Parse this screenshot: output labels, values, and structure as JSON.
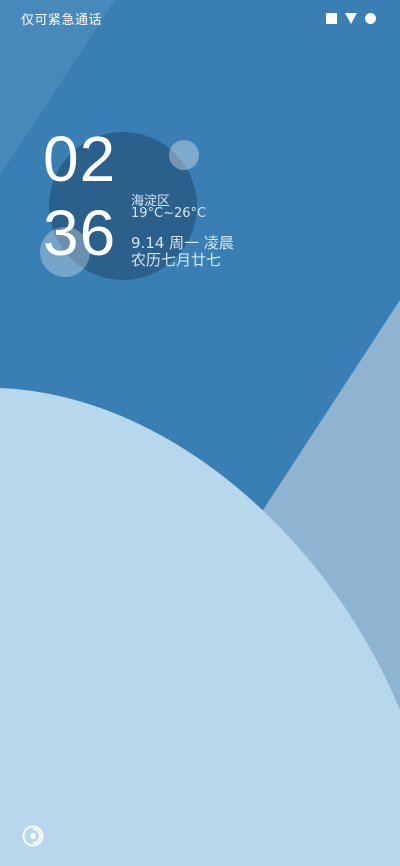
{
  "status_bar": {
    "carrier_text": "仅可紧急通话",
    "icons": [
      "square-icon",
      "wifi-triangle-icon",
      "battery-dot-icon"
    ]
  },
  "lockscreen": {
    "hour": "02",
    "minute": "36",
    "location": "海淀区",
    "temperature": "19°C~26°C",
    "date": "9.14 周一 凌晨",
    "lunar_date": "农历七月廿七"
  },
  "bottom": {
    "shortcut_icon": "camera-shortcut-icon"
  },
  "colors": {
    "background_blue": "#3a7fb3",
    "light_curve": "#b6d7ec",
    "mid_wedge": "#8fb4d1",
    "clock_circle": "#2a5f8a"
  }
}
